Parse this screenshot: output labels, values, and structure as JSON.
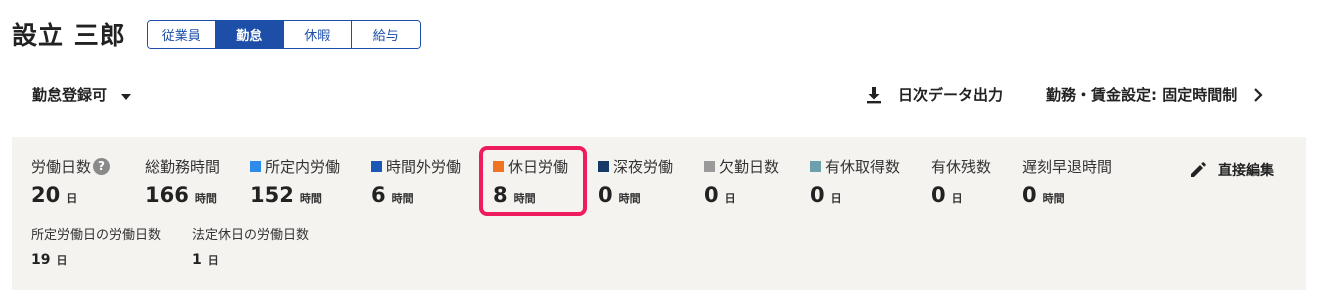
{
  "header": {
    "employee_name": "設立 三郎",
    "tabs": [
      {
        "label": "従業員",
        "active": false
      },
      {
        "label": "勤怠",
        "active": true
      },
      {
        "label": "休暇",
        "active": false
      },
      {
        "label": "給与",
        "active": false
      }
    ]
  },
  "toolbar": {
    "status_dropdown": "勤怠登録可",
    "export_label": "日次データ出力",
    "settings_label": "勤務・賃金設定: 固定時間制"
  },
  "summary": {
    "stats": [
      {
        "label": "労働日数",
        "value": "20",
        "unit": "日",
        "has_help": true
      },
      {
        "label": "総勤務時間",
        "value": "166",
        "unit": "時間"
      },
      {
        "label": "所定内労働",
        "value": "152",
        "unit": "時間",
        "color": "#2d8ceb"
      },
      {
        "label": "時間外労働",
        "value": "6",
        "unit": "時間",
        "color": "#1b57b5"
      },
      {
        "label": "休日労働",
        "value": "8",
        "unit": "時間",
        "color": "#ef7323",
        "highlighted": true
      },
      {
        "label": "深夜労働",
        "value": "0",
        "unit": "時間",
        "color": "#163a66"
      },
      {
        "label": "欠勤日数",
        "value": "0",
        "unit": "日",
        "color": "#9a9a9a"
      },
      {
        "label": "有休取得数",
        "value": "0",
        "unit": "日",
        "color": "#6d9fad"
      },
      {
        "label": "有休残数",
        "value": "0",
        "unit": "日"
      },
      {
        "label": "遅刻早退時間",
        "value": "0",
        "unit": "時間"
      }
    ],
    "sub_stats": [
      {
        "label": "所定労働日の労働日数",
        "value": "19",
        "unit": "日"
      },
      {
        "label": "法定休日の労働日数",
        "value": "1",
        "unit": "日"
      }
    ],
    "edit_label": "直接編集",
    "help_glyph": "?"
  },
  "icons": {
    "download": "download-icon",
    "chevron": "chevron-right-icon",
    "edit": "pencil-icon",
    "caret": "caret-down-icon",
    "help": "help-icon"
  }
}
